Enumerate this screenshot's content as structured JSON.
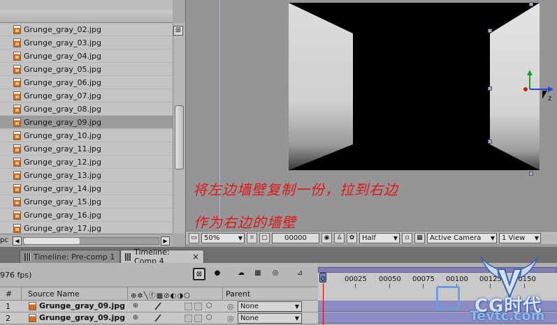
{
  "project": {
    "files": [
      {
        "name": "Grunge_gray_02.jpg",
        "selected": false
      },
      {
        "name": "Grunge_gray_03.jpg",
        "selected": false
      },
      {
        "name": "Grunge_gray_04.jpg",
        "selected": false
      },
      {
        "name": "Grunge_gray_05.jpg",
        "selected": false
      },
      {
        "name": "Grunge_gray_06.jpg",
        "selected": false
      },
      {
        "name": "Grunge_gray_07.jpg",
        "selected": false
      },
      {
        "name": "Grunge_gray_08.jpg",
        "selected": false
      },
      {
        "name": "Grunge_gray_09.jpg",
        "selected": true
      },
      {
        "name": "Grunge_gray_10.jpg",
        "selected": false
      },
      {
        "name": "Grunge_gray_11.jpg",
        "selected": false
      },
      {
        "name": "Grunge_gray_12.jpg",
        "selected": false
      },
      {
        "name": "Grunge_gray_13.jpg",
        "selected": false
      },
      {
        "name": "Grunge_gray_14.jpg",
        "selected": false
      },
      {
        "name": "Grunge_gray_15.jpg",
        "selected": false
      },
      {
        "name": "Grunge_gray_16.jpg",
        "selected": false
      },
      {
        "name": "Grunge_gray_17.jpg",
        "selected": false
      }
    ],
    "bpc_label": "pc",
    "file_icon": "jpg-file-icon"
  },
  "viewer": {
    "annotation_line1": "将左边墙壁复制一份，拉到右边",
    "annotation_line2": "作为右边的墙壁",
    "annotation_color": "#e01515",
    "axis_label": "z",
    "toolbar": {
      "zoom": "50%",
      "timecode": "00000",
      "resolution": "Half",
      "camera": "Active Camera",
      "view_layout": "1 View"
    }
  },
  "timeline": {
    "tabs": [
      {
        "label": "Timeline: Pre-comp 1",
        "active": false
      },
      {
        "label": "Timeline: Comp 4",
        "active": true
      }
    ],
    "close_glyph": "×",
    "fps": "976 fps)",
    "columns": {
      "number": "#",
      "source_name": "Source Name",
      "parent": "Parent"
    },
    "layers": [
      {
        "number": "1",
        "name": "Grunge_gray_09.jpg",
        "parent": "None"
      },
      {
        "number": "2",
        "name": "Grunge_gray_09.jpg",
        "parent": "None"
      }
    ],
    "ruler_ticks": [
      "0",
      "00025",
      "00050",
      "00075",
      "00100",
      "00125",
      "00150"
    ],
    "layer_bar_color": "#8c8cc4",
    "playhead_color": "#e00000"
  },
  "watermark": {
    "logo_text": "CG时代",
    "domain": "Tevtc.com"
  }
}
